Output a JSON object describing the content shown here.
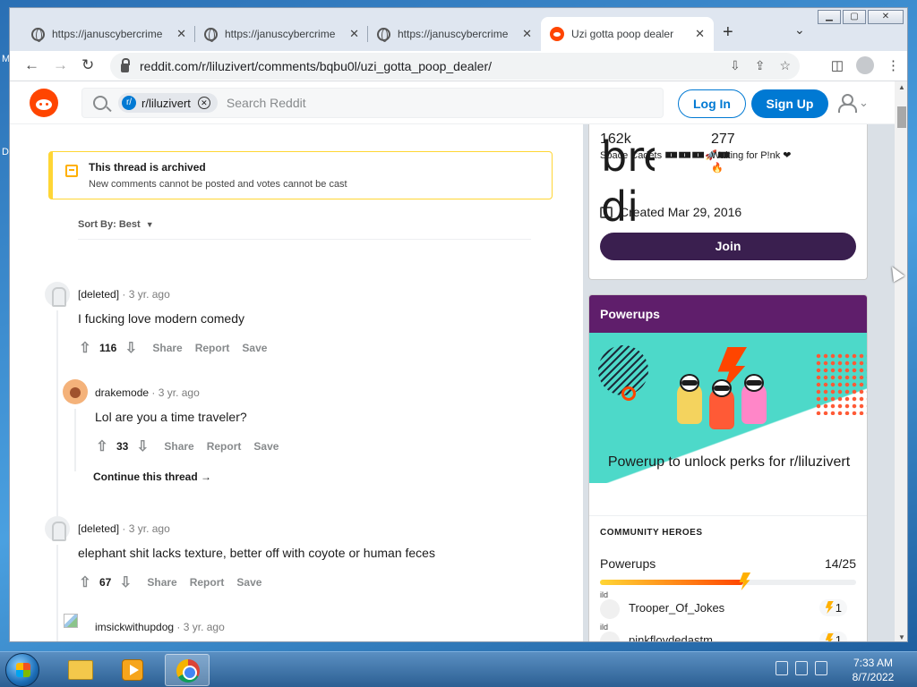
{
  "desktop": {
    "letters": [
      "M",
      "D"
    ]
  },
  "browser": {
    "tabs": [
      {
        "title": "https://januscybercrime",
        "active": false
      },
      {
        "title": "https://januscybercrime",
        "active": false
      },
      {
        "title": "https://januscybercrime",
        "active": false
      },
      {
        "title": "Uzi gotta poop dealer",
        "active": true
      }
    ],
    "url": "reddit.com/r/liluzivert/comments/bqbu0l/uzi_gotta_poop_dealer/"
  },
  "reddit": {
    "search_chip": "r/liluzivert",
    "search_placeholder": "Search Reddit",
    "login_label": "Log In",
    "signup_label": "Sign Up",
    "archived_title": "This thread is archived",
    "archived_text": "New comments cannot be posted and votes cannot be cast",
    "sort_label": "Sort By: Best",
    "comments": [
      {
        "author": "[deleted]",
        "time": "· 3 yr. ago",
        "body": "I fucking love modern comedy",
        "score": "116"
      },
      {
        "author": "drakemode",
        "time": "· 3 yr. ago",
        "body": "Lol are you a time traveler?",
        "score": "33"
      },
      {
        "author": "[deleted]",
        "time": "· 3 yr. ago",
        "body": "elephant shit lacks texture, better off with coyote or human feces",
        "score": "67"
      },
      {
        "author": "imsickwithupdog",
        "time": "· 3 yr. ago"
      }
    ],
    "actions": {
      "share": "Share",
      "report": "Report",
      "save": "Save"
    },
    "continue_thread": "Continue this thread →",
    "sidebar": {
      "members_count": "162k",
      "members_label": "Space Cadets 🀰🀰🀰🚀🀰",
      "online_count": "277",
      "online_label": "Waiting for P!nk ❤",
      "online_label2": "🔥",
      "big_text": "bred di",
      "created": "Created Mar 29, 2016",
      "join_label": "Join"
    },
    "powerups": {
      "header": "Powerups",
      "title": "Powerup to unlock perks for r/liluzivert",
      "heroes_heading": "COMMUNITY HEROES",
      "row_label": "Powerups",
      "row_count": "14/25",
      "progress": 0.56,
      "heroes": [
        {
          "alt": "ild",
          "name": "Trooper_Of_Jokes",
          "badge": "1"
        },
        {
          "alt": "ild",
          "name": "pinkfloydedastm",
          "badge": "1"
        }
      ]
    }
  },
  "taskbar": {
    "time": "7:33 AM",
    "date": "8/7/2022"
  }
}
